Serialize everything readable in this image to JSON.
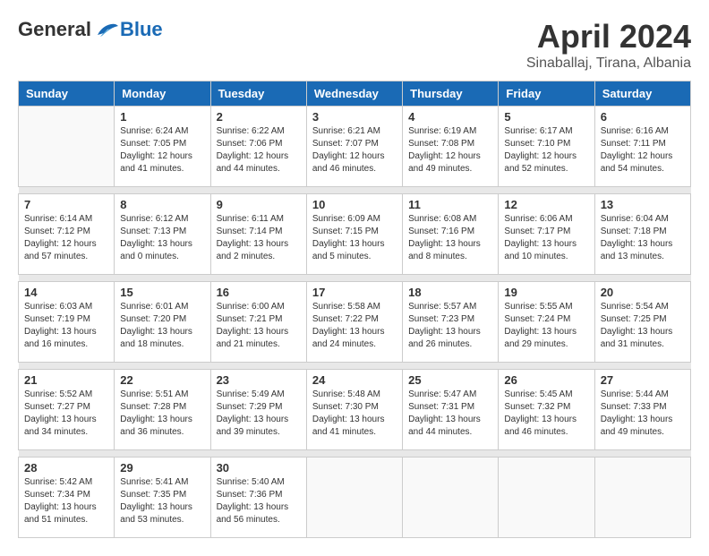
{
  "header": {
    "logo": {
      "general": "General",
      "blue": "Blue"
    },
    "title": "April 2024",
    "location": "Sinaballaj, Tirana, Albania"
  },
  "weekdays": [
    "Sunday",
    "Monday",
    "Tuesday",
    "Wednesday",
    "Thursday",
    "Friday",
    "Saturday"
  ],
  "weeks": [
    [
      {
        "day": "",
        "sunrise": "",
        "sunset": "",
        "daylight": ""
      },
      {
        "day": "1",
        "sunrise": "Sunrise: 6:24 AM",
        "sunset": "Sunset: 7:05 PM",
        "daylight": "Daylight: 12 hours and 41 minutes."
      },
      {
        "day": "2",
        "sunrise": "Sunrise: 6:22 AM",
        "sunset": "Sunset: 7:06 PM",
        "daylight": "Daylight: 12 hours and 44 minutes."
      },
      {
        "day": "3",
        "sunrise": "Sunrise: 6:21 AM",
        "sunset": "Sunset: 7:07 PM",
        "daylight": "Daylight: 12 hours and 46 minutes."
      },
      {
        "day": "4",
        "sunrise": "Sunrise: 6:19 AM",
        "sunset": "Sunset: 7:08 PM",
        "daylight": "Daylight: 12 hours and 49 minutes."
      },
      {
        "day": "5",
        "sunrise": "Sunrise: 6:17 AM",
        "sunset": "Sunset: 7:10 PM",
        "daylight": "Daylight: 12 hours and 52 minutes."
      },
      {
        "day": "6",
        "sunrise": "Sunrise: 6:16 AM",
        "sunset": "Sunset: 7:11 PM",
        "daylight": "Daylight: 12 hours and 54 minutes."
      }
    ],
    [
      {
        "day": "7",
        "sunrise": "Sunrise: 6:14 AM",
        "sunset": "Sunset: 7:12 PM",
        "daylight": "Daylight: 12 hours and 57 minutes."
      },
      {
        "day": "8",
        "sunrise": "Sunrise: 6:12 AM",
        "sunset": "Sunset: 7:13 PM",
        "daylight": "Daylight: 13 hours and 0 minutes."
      },
      {
        "day": "9",
        "sunrise": "Sunrise: 6:11 AM",
        "sunset": "Sunset: 7:14 PM",
        "daylight": "Daylight: 13 hours and 2 minutes."
      },
      {
        "day": "10",
        "sunrise": "Sunrise: 6:09 AM",
        "sunset": "Sunset: 7:15 PM",
        "daylight": "Daylight: 13 hours and 5 minutes."
      },
      {
        "day": "11",
        "sunrise": "Sunrise: 6:08 AM",
        "sunset": "Sunset: 7:16 PM",
        "daylight": "Daylight: 13 hours and 8 minutes."
      },
      {
        "day": "12",
        "sunrise": "Sunrise: 6:06 AM",
        "sunset": "Sunset: 7:17 PM",
        "daylight": "Daylight: 13 hours and 10 minutes."
      },
      {
        "day": "13",
        "sunrise": "Sunrise: 6:04 AM",
        "sunset": "Sunset: 7:18 PM",
        "daylight": "Daylight: 13 hours and 13 minutes."
      }
    ],
    [
      {
        "day": "14",
        "sunrise": "Sunrise: 6:03 AM",
        "sunset": "Sunset: 7:19 PM",
        "daylight": "Daylight: 13 hours and 16 minutes."
      },
      {
        "day": "15",
        "sunrise": "Sunrise: 6:01 AM",
        "sunset": "Sunset: 7:20 PM",
        "daylight": "Daylight: 13 hours and 18 minutes."
      },
      {
        "day": "16",
        "sunrise": "Sunrise: 6:00 AM",
        "sunset": "Sunset: 7:21 PM",
        "daylight": "Daylight: 13 hours and 21 minutes."
      },
      {
        "day": "17",
        "sunrise": "Sunrise: 5:58 AM",
        "sunset": "Sunset: 7:22 PM",
        "daylight": "Daylight: 13 hours and 24 minutes."
      },
      {
        "day": "18",
        "sunrise": "Sunrise: 5:57 AM",
        "sunset": "Sunset: 7:23 PM",
        "daylight": "Daylight: 13 hours and 26 minutes."
      },
      {
        "day": "19",
        "sunrise": "Sunrise: 5:55 AM",
        "sunset": "Sunset: 7:24 PM",
        "daylight": "Daylight: 13 hours and 29 minutes."
      },
      {
        "day": "20",
        "sunrise": "Sunrise: 5:54 AM",
        "sunset": "Sunset: 7:25 PM",
        "daylight": "Daylight: 13 hours and 31 minutes."
      }
    ],
    [
      {
        "day": "21",
        "sunrise": "Sunrise: 5:52 AM",
        "sunset": "Sunset: 7:27 PM",
        "daylight": "Daylight: 13 hours and 34 minutes."
      },
      {
        "day": "22",
        "sunrise": "Sunrise: 5:51 AM",
        "sunset": "Sunset: 7:28 PM",
        "daylight": "Daylight: 13 hours and 36 minutes."
      },
      {
        "day": "23",
        "sunrise": "Sunrise: 5:49 AM",
        "sunset": "Sunset: 7:29 PM",
        "daylight": "Daylight: 13 hours and 39 minutes."
      },
      {
        "day": "24",
        "sunrise": "Sunrise: 5:48 AM",
        "sunset": "Sunset: 7:30 PM",
        "daylight": "Daylight: 13 hours and 41 minutes."
      },
      {
        "day": "25",
        "sunrise": "Sunrise: 5:47 AM",
        "sunset": "Sunset: 7:31 PM",
        "daylight": "Daylight: 13 hours and 44 minutes."
      },
      {
        "day": "26",
        "sunrise": "Sunrise: 5:45 AM",
        "sunset": "Sunset: 7:32 PM",
        "daylight": "Daylight: 13 hours and 46 minutes."
      },
      {
        "day": "27",
        "sunrise": "Sunrise: 5:44 AM",
        "sunset": "Sunset: 7:33 PM",
        "daylight": "Daylight: 13 hours and 49 minutes."
      }
    ],
    [
      {
        "day": "28",
        "sunrise": "Sunrise: 5:42 AM",
        "sunset": "Sunset: 7:34 PM",
        "daylight": "Daylight: 13 hours and 51 minutes."
      },
      {
        "day": "29",
        "sunrise": "Sunrise: 5:41 AM",
        "sunset": "Sunset: 7:35 PM",
        "daylight": "Daylight: 13 hours and 53 minutes."
      },
      {
        "day": "30",
        "sunrise": "Sunrise: 5:40 AM",
        "sunset": "Sunset: 7:36 PM",
        "daylight": "Daylight: 13 hours and 56 minutes."
      },
      {
        "day": "",
        "sunrise": "",
        "sunset": "",
        "daylight": ""
      },
      {
        "day": "",
        "sunrise": "",
        "sunset": "",
        "daylight": ""
      },
      {
        "day": "",
        "sunrise": "",
        "sunset": "",
        "daylight": ""
      },
      {
        "day": "",
        "sunrise": "",
        "sunset": "",
        "daylight": ""
      }
    ]
  ]
}
